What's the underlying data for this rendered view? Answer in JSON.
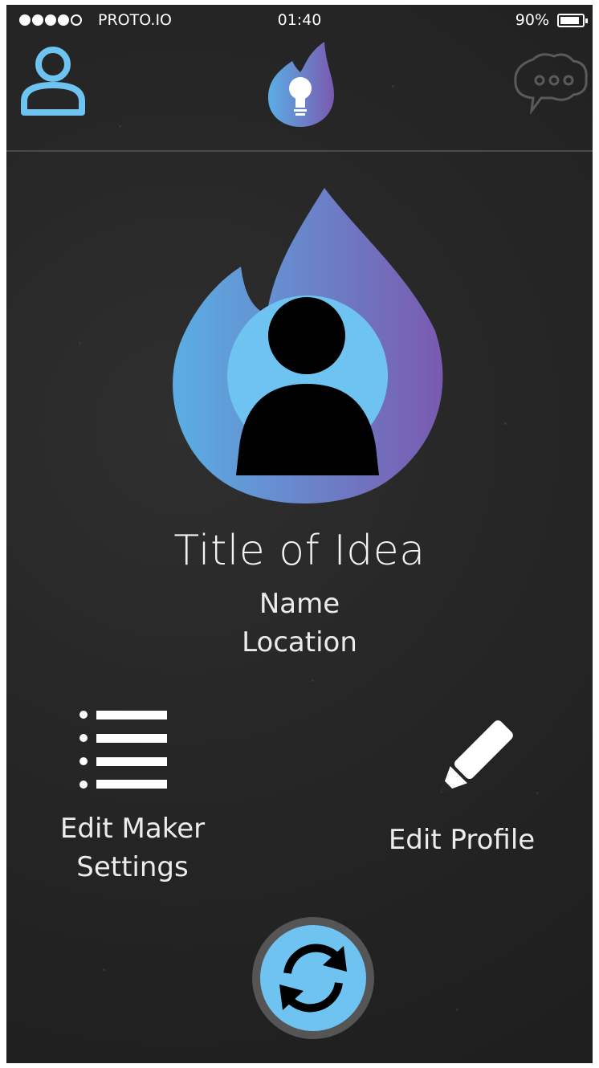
{
  "status_bar": {
    "carrier": "PROTO.IO",
    "time": "01:40",
    "battery_percent": "90%",
    "battery_level": 0.9,
    "signal_bars": 4,
    "signal_total": 5
  },
  "nav": {
    "left_icon": "user-icon",
    "center_icon": "flame-lightbulb-logo-icon",
    "right_icon": "chat-bubble-icon"
  },
  "profile": {
    "icon": "flame-avatar-icon",
    "title": "Title of Idea",
    "name": "Name",
    "location": "Location"
  },
  "actions": {
    "maker_settings": {
      "icon": "list-icon",
      "label_line1": "Edit Maker",
      "label_line2": "Settings"
    },
    "edit_profile": {
      "icon": "pencil-icon",
      "label": "Edit Profile"
    }
  },
  "refresh": {
    "icon": "refresh-icon"
  },
  "colors": {
    "accent_blue": "#6ec3f1",
    "flame_blue": "#5aaee4",
    "flame_purple": "#7a5ab0",
    "background": "#262626",
    "text": "#ececec"
  }
}
